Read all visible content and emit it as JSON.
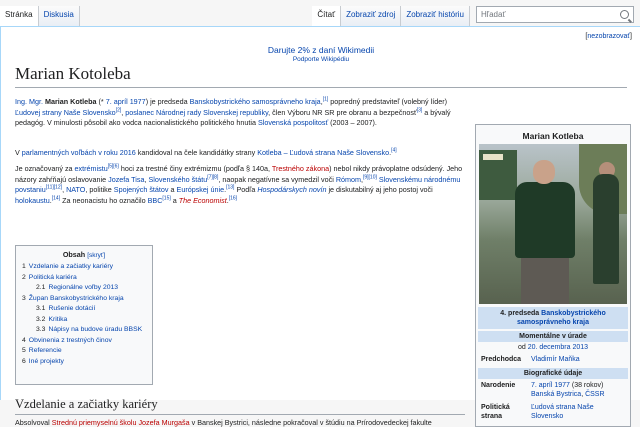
{
  "tabs_left": [
    "Stránka",
    "Diskusia"
  ],
  "tabs_right": [
    "Čítať",
    "Zobraziť zdroj",
    "Zobraziť históriu"
  ],
  "search": {
    "placeholder": "Hľadať"
  },
  "hide_banner": "nezobrazovať",
  "banner": {
    "main": "Darujte 2% z daní Wikimedii",
    "sub": "Podporte Wikipédiu"
  },
  "title": "Marian Kotoleba",
  "paragraphs": {
    "p1": {
      "a": "Ing. Mgr.",
      "b": "Marian Kotleba",
      "c": "(*",
      "d": "7. apríl",
      "e": "1977",
      "f": ") je predseda",
      "g": "Banskobystrického samosprávneho kraja",
      "h": ",",
      "ref1": "[1]",
      "i": "popredný predstaviteľ (volebný líder)",
      "j": "Ľudovej strany Naše Slovensko",
      "ref2": "[2]",
      "k": ",",
      "l": "poslanec Národnej rady Slovenskej republiky",
      "m": ", člen Výboru NR SR pre obranu a bezpečnosť",
      "ref3": "[3]",
      "n": "a bývalý pedagóg. V minulosti pôsobil ako vodca nacionalistického politického hnutia",
      "o": "Slovenská pospolitosť",
      "p": "(2003 – 2007)."
    },
    "p2": {
      "a": "V",
      "b": "parlamentných voľbách v roku 2016",
      "c": "kandidoval na čele kandidátky strany",
      "d": "Kotleba – Ľudová strana Naše Slovensko",
      "e": ".",
      "ref4": "[4]"
    },
    "p3": {
      "a": "Je označovaný za",
      "b": "extrémistu",
      "ref5": "[5][6]",
      "c": "hoci za trestné činy extrémizmu (podľa § 140a,",
      "d": "Trestného zákona",
      "e": ") nebol nikdy právoplatne odsúdený. Jeho názory zahŕňajú oslavovanie",
      "f": "Jozefa Tisa",
      "g": ",",
      "h": "Slovenského štátu",
      "ref7": "[7][8]",
      "i": ", naopak negatívne sa vymedzil voči",
      "j": "Rómom",
      "k": ",",
      "ref9": "[9][10]",
      "l": "Slovenskému národnému povstaniu",
      "ref11": "[11][12]",
      "m": ",",
      "n": "NATO",
      "o": ", politike",
      "p": "Spojených štátov",
      "q": "a",
      "r": "Európskej únie",
      "s": ".",
      "ref13": "[13]",
      "t": "Podľa",
      "u": "Hospodárskych novín",
      "v": "je diskutabilný aj jeho postoj voči",
      "w": "holokaustu",
      "x": ".",
      "ref14": "[14]",
      "y": "Za neonacistu ho označilo",
      "z": "BBC",
      "ref15": "[15]",
      "aa": "a",
      "bb": "The Economist",
      "cc": ".",
      "ref16": "[16]"
    }
  },
  "toc": {
    "title": "Obsah",
    "toggle": "[skryť]",
    "items": [
      {
        "num": "1",
        "label": "Vzdelanie a začiatky kariéry",
        "level": 1
      },
      {
        "num": "2",
        "label": "Politická kariéra",
        "level": 1
      },
      {
        "num": "2.1",
        "label": "Regionálne voľby 2013",
        "level": 2
      },
      {
        "num": "3",
        "label": "Župan Banskobystrického kraja",
        "level": 1
      },
      {
        "num": "3.1",
        "label": "Rušenie dotácií",
        "level": 2
      },
      {
        "num": "3.2",
        "label": "Kritika",
        "level": 2
      },
      {
        "num": "3.3",
        "label": "Nápisy na budove úradu BBSK",
        "level": 2
      },
      {
        "num": "4",
        "label": "Obvinenia z trestných činov",
        "level": 1
      },
      {
        "num": "5",
        "label": "Referencie",
        "level": 1
      },
      {
        "num": "6",
        "label": "Iné projekty",
        "level": 1
      }
    ]
  },
  "section1": {
    "heading": "Vzdelanie a začiatky kariéry",
    "line_a": "Absolvoval",
    "line_link": "Strednú priemyselnú školu Jozefa Murgaša",
    "line_b": "v Banskej Bystrici, následne pokračoval v štúdiu na Prírodovedeckej fakulte"
  },
  "infobox": {
    "title": "Marian Kotleba",
    "caption_a": "4. predseda",
    "caption_link": "Banskobystrického samosprávneho kraja",
    "status": "Momentálne v úrade",
    "since_a": "od",
    "since_link": "20. decembra 2013",
    "predecessor_label": "Predchodca",
    "predecessor": "Vladimír Maňka",
    "bio_header": "Biografické údaje",
    "birth_label": "Narodenie",
    "birth_date": "7. apríl 1977",
    "birth_age": "(38 rokov)",
    "birth_place": "Banská Bystrica",
    "birth_country": "ČSSR",
    "party_label": "Politická strana",
    "party": "Ľudová strana Naše Slovensko"
  },
  "colors": {
    "link": "#0645ad",
    "redlink": "#ba0000",
    "infobox_band": "#cedff2"
  }
}
